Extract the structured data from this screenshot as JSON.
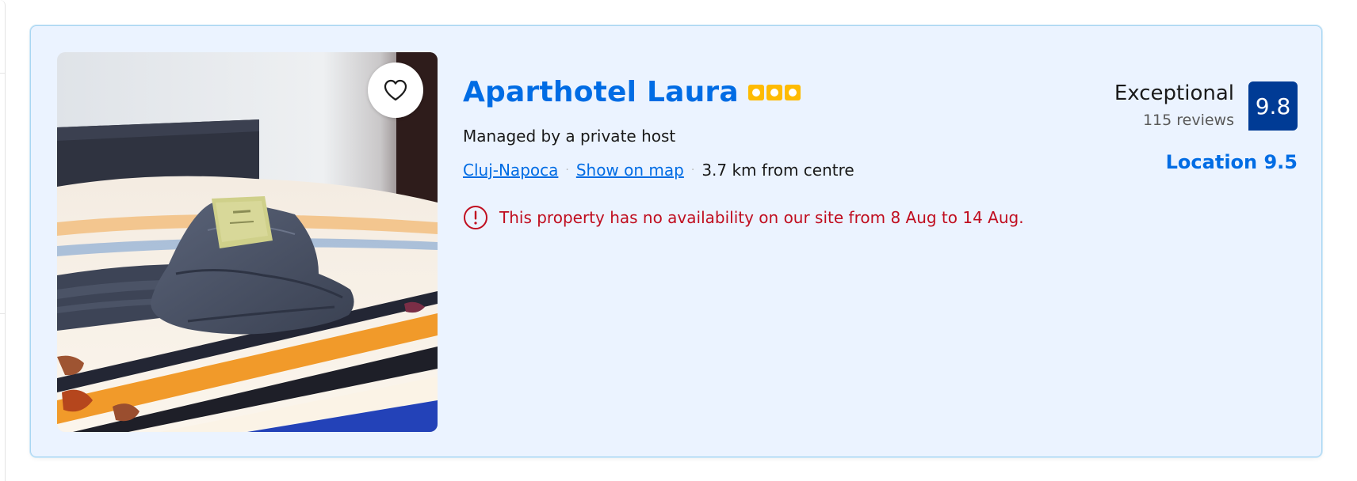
{
  "property": {
    "name": "Aparthotel Laura",
    "star_count": 3,
    "host_type": "Managed by a private host",
    "city_link": "Cluj-Napoca",
    "map_link": "Show on map",
    "separator": "·",
    "distance": "3.7 km from centre",
    "availability_warning": "This property has no availability on our site from 8 Aug to 14 Aug."
  },
  "review": {
    "rating_word": "Exceptional",
    "review_count": "115 reviews",
    "score": "9.8",
    "location_score": "Location 9.5"
  },
  "icons": {
    "favorite": "heart-outline-icon",
    "warning": "exclamation-circle-icon",
    "star": "square-star-icon"
  },
  "colors": {
    "brand_blue": "#006ce4",
    "score_badge": "#003b95",
    "star_yellow": "#febb02",
    "warning_red": "#c00d1f",
    "card_background": "#ebf3ff",
    "card_border": "#a8d6f2"
  }
}
